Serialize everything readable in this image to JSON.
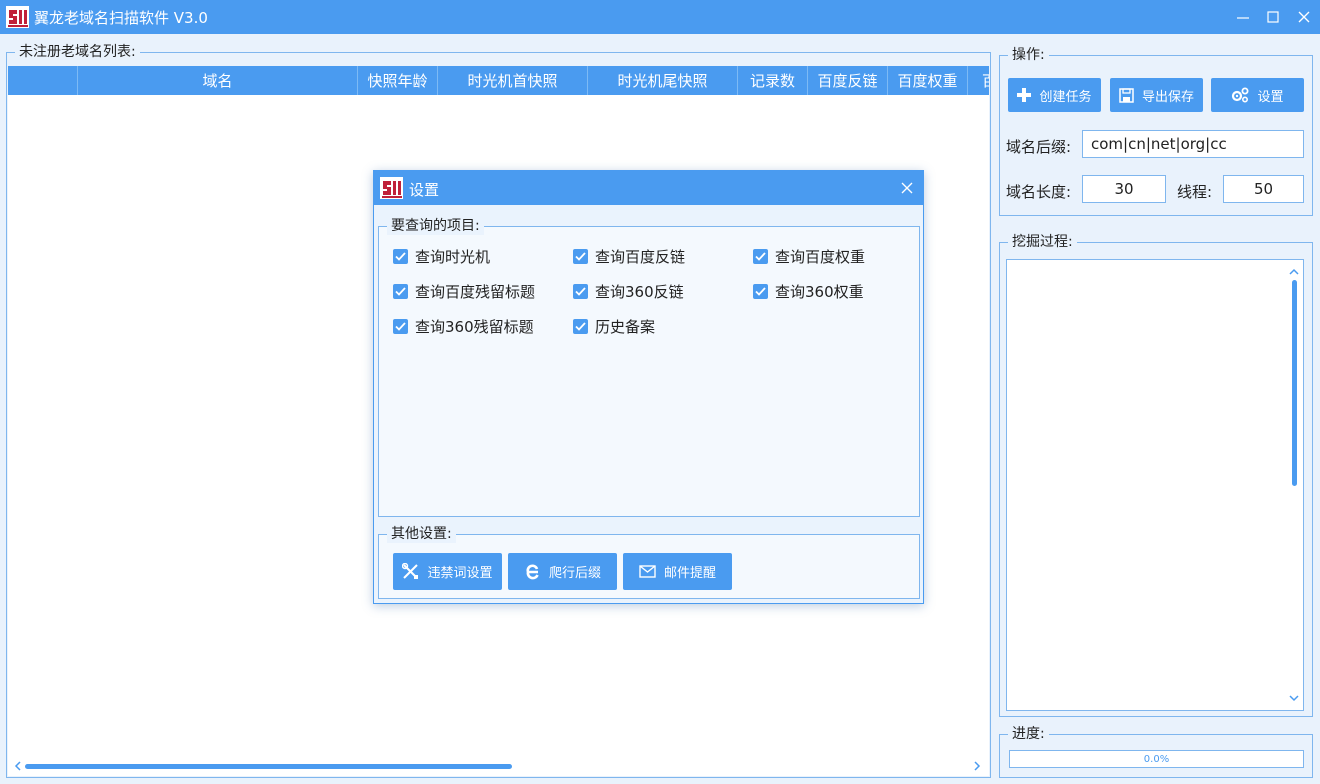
{
  "window": {
    "title": "翼龙老域名扫描软件 V3.0",
    "logo_icon": "app-logo-icon"
  },
  "colors": {
    "accent": "#4a9bf0",
    "logo": "#c0203a",
    "background": "#e9f2fc"
  },
  "left_panel": {
    "legend": "未注册老域名列表:",
    "columns": [
      "",
      "域名",
      "快照年龄",
      "时光机首快照",
      "时光机尾快照",
      "记录数",
      "百度反链",
      "百度权重",
      "百"
    ],
    "rows": []
  },
  "operations": {
    "legend": "操作:",
    "buttons": [
      {
        "label": "创建任务",
        "icon": "plus-icon"
      },
      {
        "label": "导出保存",
        "icon": "save-icon"
      },
      {
        "label": "设置",
        "icon": "gears-icon"
      }
    ],
    "suffix_label": "域名后缀:",
    "suffix_value": "com|cn|net|org|cc",
    "length_label": "域名长度:",
    "length_value": "30",
    "threads_label": "线程:",
    "threads_value": "50"
  },
  "process": {
    "legend": "挖掘过程:"
  },
  "progress": {
    "legend": "进度:",
    "text": "0.0%",
    "fraction": 0.0
  },
  "dialog": {
    "title": "设置",
    "query_legend": "要查询的项目:",
    "checkboxes": [
      {
        "label": "查询时光机",
        "checked": true
      },
      {
        "label": "查询百度反链",
        "checked": true
      },
      {
        "label": "查询百度权重",
        "checked": true
      },
      {
        "label": "查询百度残留标题",
        "checked": true
      },
      {
        "label": "查询360反链",
        "checked": true
      },
      {
        "label": "查询360权重",
        "checked": true
      },
      {
        "label": "查询360残留标题",
        "checked": true
      },
      {
        "label": "历史备案",
        "checked": true
      }
    ],
    "other_legend": "其他设置:",
    "buttons": [
      {
        "label": "违禁词设置",
        "icon": "tools-icon"
      },
      {
        "label": "爬行后缀",
        "icon": "browser-e-icon"
      },
      {
        "label": "邮件提醒",
        "icon": "envelope-icon"
      }
    ]
  }
}
